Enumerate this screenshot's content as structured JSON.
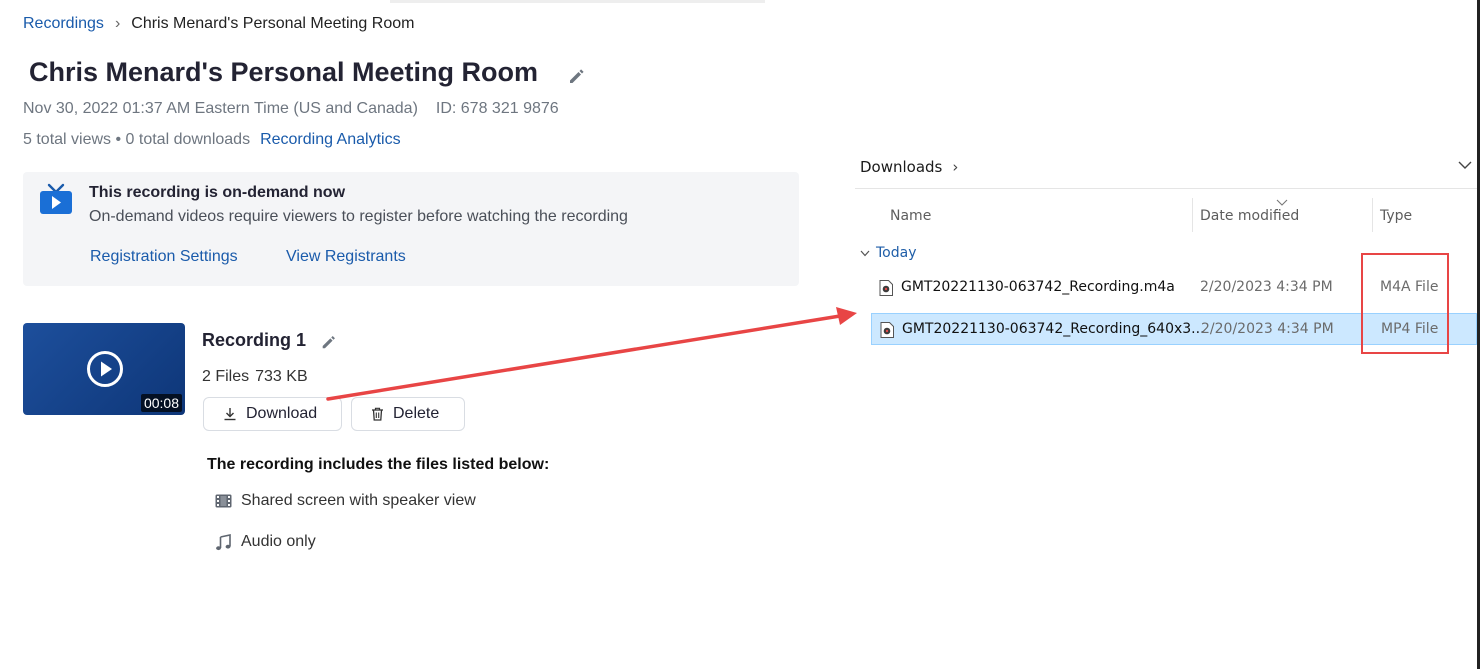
{
  "breadcrumb": {
    "root": "Recordings",
    "separator": "›",
    "current": "Chris Menard's Personal Meeting Room"
  },
  "meeting": {
    "title": "Chris Menard's Personal Meeting Room",
    "datetime": "Nov 30, 2022 01:37 AM Eastern Time (US and Canada)",
    "id_text": "ID: 678 321 9876",
    "stats": "5 total views • 0 total downloads",
    "analytics_link": "Recording Analytics"
  },
  "banner": {
    "title": "This recording is on-demand now",
    "subtitle": "On-demand videos require viewers to register before watching the recording",
    "link_settings": "Registration Settings",
    "link_registrants": "View Registrants",
    "icon": "tv-icon"
  },
  "recording": {
    "name": "Recording 1",
    "duration": "00:08",
    "files_count": "2 Files",
    "size": "733 KB",
    "download_label": "Download",
    "delete_label": "Delete",
    "files_heading": "The recording includes the files listed below:",
    "files": [
      {
        "label": "Shared screen with speaker view",
        "icon": "film-icon"
      },
      {
        "label": "Audio only",
        "icon": "music-note-icon"
      }
    ]
  },
  "explorer": {
    "location": "Downloads",
    "location_chevron": "›",
    "columns": {
      "name": "Name",
      "date": "Date modified",
      "type": "Type"
    },
    "group": "Today",
    "rows": [
      {
        "name": "GMT20221130-063742_Recording.m4a",
        "date": "2/20/2023 4:34 PM",
        "type": "M4A File",
        "selected": false
      },
      {
        "name": "GMT20221130-063742_Recording_640x3...",
        "date": "2/20/2023 4:34 PM",
        "type": "MP4 File",
        "selected": true
      }
    ]
  },
  "colors": {
    "link": "#1a5bab",
    "annotation": "#e84545",
    "selection": "#cce8ff",
    "thumbnail": "#1d4f9c"
  }
}
